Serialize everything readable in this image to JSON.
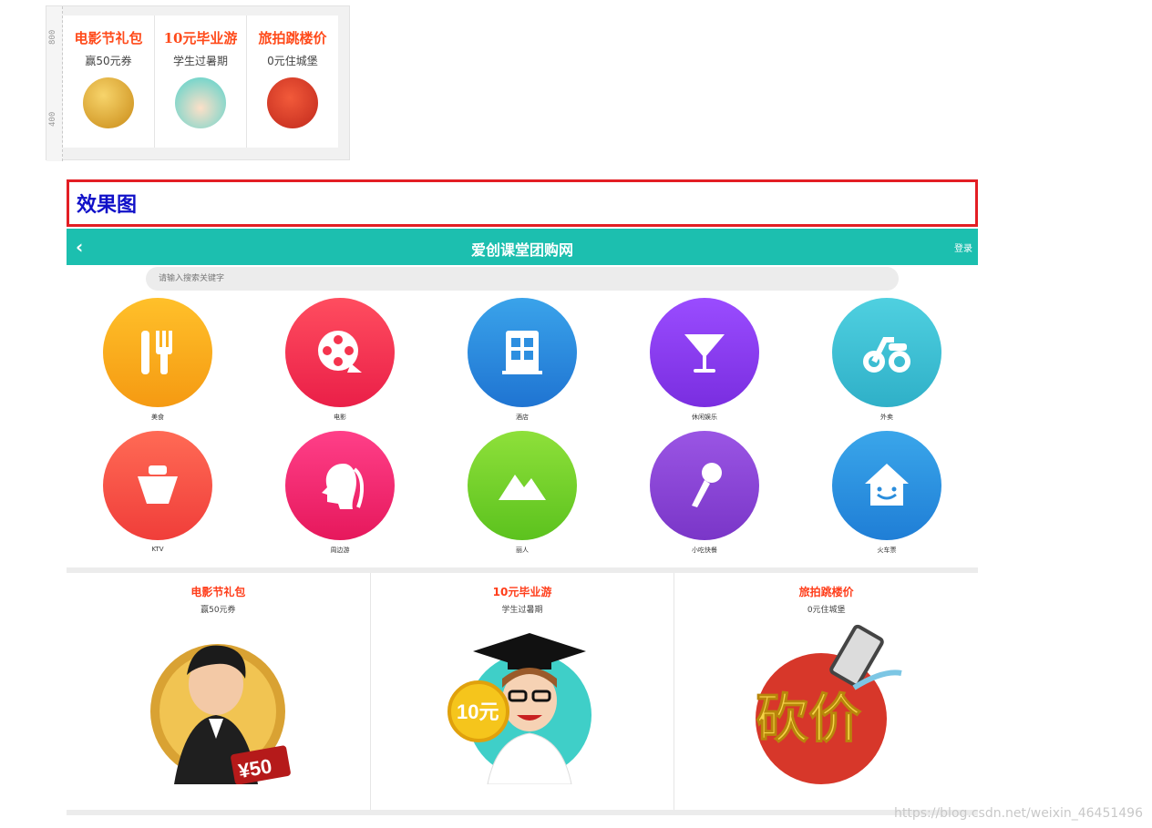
{
  "preview": {
    "ruler": [
      "800",
      "400"
    ],
    "cards": [
      {
        "title": "电影节礼包",
        "subtitle": "赢50元券"
      },
      {
        "title": "10元毕业游",
        "subtitle": "学生过暑期"
      },
      {
        "title": "旅拍跳楼价",
        "subtitle": "0元住城堡"
      }
    ]
  },
  "effect_label": "效果图",
  "header": {
    "back_icon": "chevron-left-icon",
    "title": "爱创课堂团购网",
    "login": "登录"
  },
  "search": {
    "placeholder": "请输入搜索关键字"
  },
  "categories": [
    {
      "label": "美食",
      "icon": "utensils-icon",
      "color": "#fbad1d"
    },
    {
      "label": "电影",
      "icon": "film-reel-icon",
      "color": "#f5344e"
    },
    {
      "label": "酒店",
      "icon": "building-icon",
      "color": "#2d8fe0"
    },
    {
      "label": "休闲娱乐",
      "icon": "cocktail-icon",
      "color": "#8b3ff0"
    },
    {
      "label": "外卖",
      "icon": "scooter-icon",
      "color": "#3bbfd6"
    },
    {
      "label": "KTV",
      "icon": "ktv-icon",
      "color": "#ff5a48"
    },
    {
      "label": "周边游",
      "icon": "profile-head-icon",
      "color": "#f0266f"
    },
    {
      "label": "丽人",
      "icon": "mountain-icon",
      "color": "#7bd22e"
    },
    {
      "label": "小吃快餐",
      "icon": "microphone-icon",
      "color": "#8e47d8"
    },
    {
      "label": "火车票",
      "icon": "house-smile-icon",
      "color": "#2a8ddc"
    }
  ],
  "promos": [
    {
      "title": "电影节礼包",
      "subtitle": "赢50元券",
      "badge": "¥50"
    },
    {
      "title": "10元毕业游",
      "subtitle": "学生过暑期",
      "badge": "10元"
    },
    {
      "title": "旅拍跳楼价",
      "subtitle": "0元住城堡",
      "badge": "砍价"
    }
  ],
  "watermark": "https://blog.csdn.net/weixin_46451496",
  "colors": {
    "accent": "#1cbfaf",
    "promo_title": "#ff3d1a",
    "effect_border": "#e31e24",
    "effect_text": "#1010c8"
  }
}
